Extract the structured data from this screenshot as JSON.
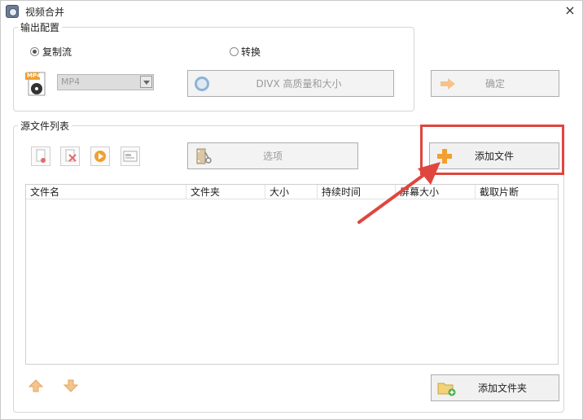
{
  "window": {
    "title": "视频合并",
    "close_glyph": "×"
  },
  "output_group": {
    "legend": "输出配置",
    "radio_copy_label": "复制流",
    "radio_convert_label": "转换",
    "format_value": "MP4",
    "format_icon_label": "MP4",
    "profile_button_label": "DIVX 高质量和大小",
    "confirm_button_label": "确定"
  },
  "source_group": {
    "legend": "源文件列表",
    "options_button_label": "选项",
    "add_file_button_label": "添加文件",
    "add_folder_button_label": "添加文件夹",
    "columns": [
      "文件名",
      "文件夹",
      "大小",
      "持续时间",
      "屏幕大小",
      "截取片断"
    ]
  },
  "colors": {
    "accent": "#f0a030",
    "annotation": "#e0453e"
  }
}
